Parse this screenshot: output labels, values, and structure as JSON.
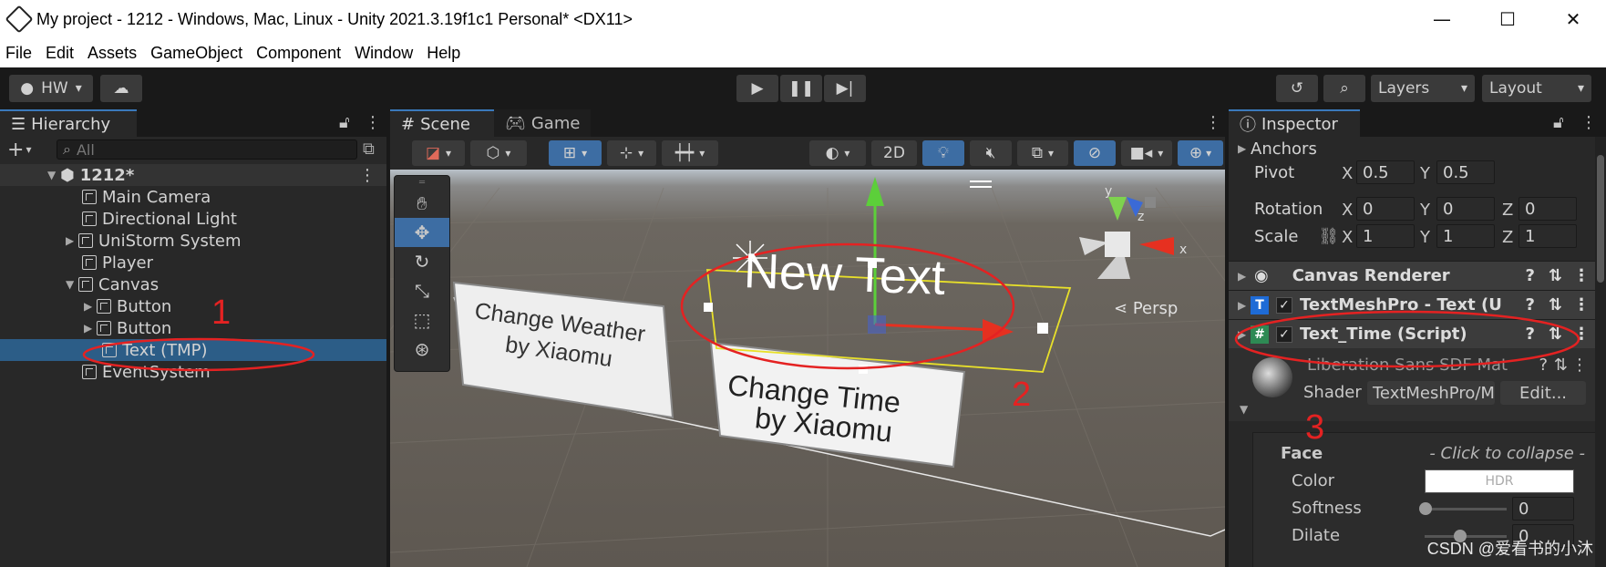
{
  "window": {
    "title": "My project - 1212 - Windows, Mac, Linux - Unity 2021.3.19f1c1 Personal* <DX11>",
    "minimize": "—",
    "maximize": "☐",
    "close": "✕"
  },
  "menu": [
    "File",
    "Edit",
    "Assets",
    "GameObject",
    "Component",
    "Window",
    "Help"
  ],
  "toolbar": {
    "account": "HW",
    "layers": "Layers",
    "layout": "Layout"
  },
  "hierarchy": {
    "tab": "Hierarchy",
    "search_placeholder": "All",
    "scene": "1212*",
    "items": [
      {
        "label": "Main Camera"
      },
      {
        "label": "Directional Light"
      },
      {
        "label": "UniStorm System"
      },
      {
        "label": "Player"
      },
      {
        "label": "Canvas"
      },
      {
        "label": "Button"
      },
      {
        "label": "Button"
      },
      {
        "label": "Text (TMP)"
      },
      {
        "label": "EventSystem"
      }
    ]
  },
  "scene": {
    "tab_scene": "Scene",
    "tab_game": "Game",
    "mode_2d": "2D",
    "persp": "Persp",
    "gizmo_y": "y",
    "gizmo_z": "z",
    "gizmo_x": "x",
    "text_object": "New Text",
    "button1_line1": "Change Weather",
    "button1_line2": "by Xiaomu",
    "button2_line1": "Change Time",
    "button2_line2": "by Xiaomu"
  },
  "inspector": {
    "tab": "Inspector",
    "anchors": "Anchors",
    "pivot_label": "Pivot",
    "pivot_x": "0.5",
    "pivot_y": "0.5",
    "rotation_label": "Rotation",
    "rotation_x": "0",
    "rotation_y": "0",
    "rotation_z": "0",
    "scale_label": "Scale",
    "scale_x": "1",
    "scale_y": "1",
    "scale_z": "1",
    "axis_x": "X",
    "axis_y": "Y",
    "axis_z": "Z",
    "canvas_renderer": "Canvas Renderer",
    "textmeshpro": "TextMeshPro - Text (U",
    "text_time": "Text_Time (Script)",
    "material": "Liberation Sans SDF Mat",
    "shader_label": "Shader",
    "shader_value": "TextMeshPro/M",
    "edit_button": "Edit...",
    "face_label": "Face",
    "face_hint": "- Click to collapse -",
    "color_label": "Color",
    "color_value": "HDR",
    "softness_label": "Softness",
    "softness_value": "0",
    "dilate_label": "Dilate",
    "dilate_value": "0"
  },
  "annotations": {
    "n1": "1",
    "n2": "2",
    "n3": "3"
  },
  "watermark": "CSDN @爱看书的小沐",
  "colors": {
    "selected": "#2c5d87",
    "accent": "#3a79bb",
    "annotation": "#e42222",
    "gizmo_active": "#3d6da3"
  }
}
